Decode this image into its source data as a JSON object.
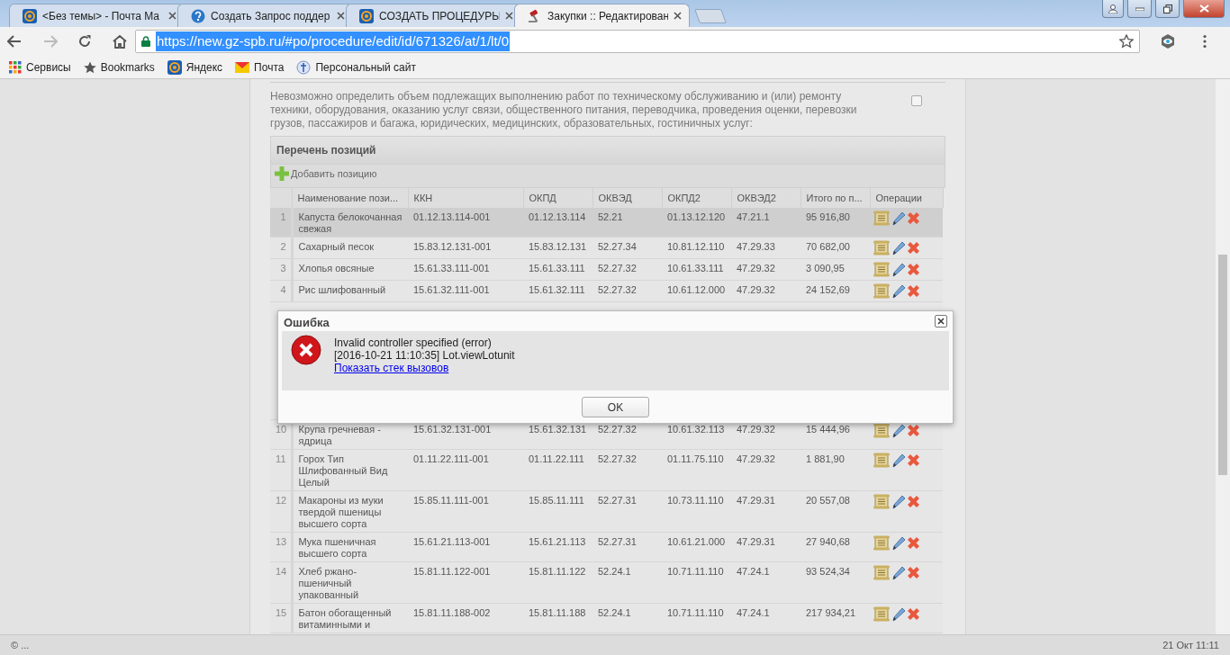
{
  "browser": {
    "tabs": [
      {
        "title": "<Без темы> - Почта Ma",
        "kind": "mail",
        "selected": false
      },
      {
        "title": "Создать Запрос поддер",
        "kind": "help",
        "selected": false
      },
      {
        "title": "СОЗДАТЬ ПРОЦЕДУРЫ",
        "kind": "mail",
        "selected": false
      },
      {
        "title": "Закупки :: Редактирован",
        "kind": "gavel",
        "selected": true
      }
    ],
    "url": "https://new.gz-spb.ru/#po/procedure/edit/id/671326/at/1/lt/0",
    "bookmarks": [
      {
        "label": "Сервисы",
        "kind": "apps"
      },
      {
        "label": "Bookmarks",
        "kind": "star"
      },
      {
        "label": "Яндекс",
        "kind": "mail"
      },
      {
        "label": "Почта",
        "kind": "envelope"
      },
      {
        "label": "Персональный сайт",
        "kind": "site"
      }
    ]
  },
  "notice": {
    "text": "Невозможно определить объем подлежащих выполнению работ по техническому обслуживанию и (или) ремонту техники, оборудования, оказанию услуг связи, общественного питания, переводчика, проведения оценки, перевозки грузов, пассажиров и багажа, юридических, медицинских, образовательных, гостиничных услуг:",
    "checked": false
  },
  "positions": {
    "title": "Перечень позиций",
    "add_button": "Добавить позицию",
    "columns": [
      "Наименование пози...",
      "ККН",
      "ОКПД",
      "ОКВЭД",
      "ОКПД2",
      "ОКВЭД2",
      "Итого по п...",
      "Операции"
    ],
    "rows": [
      {
        "number": "1",
        "cells": [
          "Капуста белокочанная свежая",
          "01.12.13.114-001",
          "01.12.13.114",
          "52.21",
          "01.13.12.120",
          "47.21.1",
          "95 916,80"
        ],
        "selected": true
      },
      {
        "number": "2",
        "cells": [
          "Сахарный песок",
          "15.83.12.131-001",
          "15.83.12.131",
          "52.27.34",
          "10.81.12.110",
          "47.29.33",
          "70 682,00"
        ],
        "selected": false
      },
      {
        "number": "3",
        "cells": [
          "Хлопья овсяные",
          "15.61.33.111-001",
          "15.61.33.111",
          "52.27.32",
          "10.61.33.111",
          "47.29.32",
          "3 090,95"
        ],
        "selected": false
      },
      {
        "number": "4",
        "cells": [
          "Рис шлифованный",
          "15.61.32.111-001",
          "15.61.32.111",
          "52.27.32",
          "10.61.12.000",
          "47.29.32",
          "24 152,69"
        ],
        "selected": false
      },
      {
        "number": "10",
        "cells": [
          "Крупа гречневая - ядрица",
          "15.61.32.131-001",
          "15.61.32.131",
          "52.27.32",
          "10.61.32.113",
          "47.29.32",
          "15 444,96"
        ],
        "selected": false,
        "after_gap": true
      },
      {
        "number": "11",
        "cells": [
          "Горох Тип Шлифованный Вид Целый",
          "01.11.22.111-001",
          "01.11.22.111",
          "52.27.32",
          "01.11.75.110",
          "47.29.32",
          "1 881,90"
        ],
        "selected": false
      },
      {
        "number": "12",
        "cells": [
          "Макароны из муки твердой пшеницы высшего сорта",
          "15.85.11.111-001",
          "15.85.11.111",
          "52.27.31",
          "10.73.11.110",
          "47.29.31",
          "20 557,08"
        ],
        "selected": false
      },
      {
        "number": "13",
        "cells": [
          "Мука пшеничная высшего сорта",
          "15.61.21.113-001",
          "15.61.21.113",
          "52.27.31",
          "10.61.21.000",
          "47.29.31",
          "27 940,68"
        ],
        "selected": false
      },
      {
        "number": "14",
        "cells": [
          "Хлеб ржано-пшеничный упакованный",
          "15.81.11.122-001",
          "15.81.11.122",
          "52.24.1",
          "10.71.11.110",
          "47.24.1",
          "93 524,34"
        ],
        "selected": false
      },
      {
        "number": "15",
        "cells": [
          "Батон обогащенный витаминными и",
          "15.81.11.188-002",
          "15.81.11.188",
          "52.24.1",
          "10.71.11.110",
          "47.24.1",
          "217 934,21"
        ],
        "selected": false
      }
    ]
  },
  "dialog": {
    "title": "Ошибка",
    "lines": [
      "Invalid controller specified (error)",
      "[2016-10-21 11:10:35] Lot.viewLotunit"
    ],
    "link": "Показать стек вызовов",
    "button": "OK"
  },
  "status_bar": {
    "left": "© ...",
    "right": "21 Окт 11:11"
  }
}
